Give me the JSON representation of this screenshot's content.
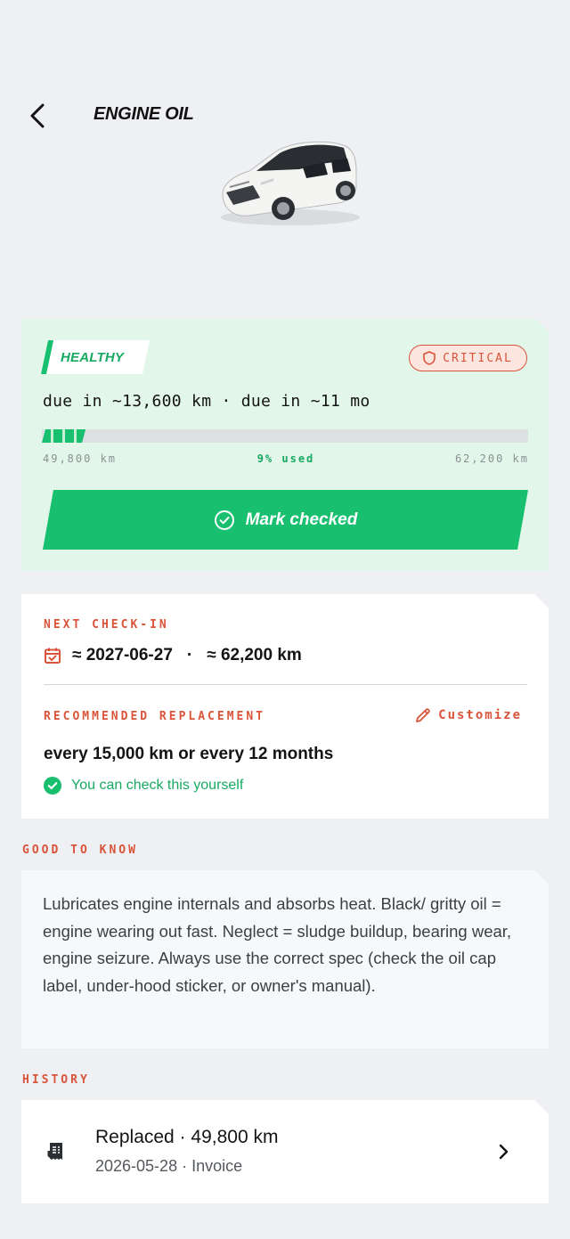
{
  "header": {
    "title": "ENGINE OIL"
  },
  "status": {
    "health": "HEALTHY",
    "severity": "CRITICAL",
    "due_text": "due in ~13,600 km · due in ~11 mo",
    "progress_fraction": 0.09,
    "range_start": "49,800 km",
    "range_used": "9% used",
    "range_end": "62,200 km",
    "mark_button": "Mark checked"
  },
  "checkin": {
    "label": "NEXT CHECK-IN",
    "date": "≈ 2027-06-27",
    "separator": "·",
    "km": "≈ 62,200 km",
    "recommended_label": "RECOMMENDED REPLACEMENT",
    "customize": "Customize",
    "recommended_value": "every 15,000 km or every 12 months",
    "self_check": "You can check this yourself"
  },
  "good_to_know": {
    "label": "GOOD TO KNOW",
    "text": "Lubricates engine internals and absorbs heat. Black/ gritty oil = engine wearing out fast. Neglect = sludge buildup, bearing wear, engine seizure. Always use the correct spec (check the oil cap label, under-hood sticker, or owner's manual)."
  },
  "history": {
    "label": "HISTORY",
    "items": [
      {
        "title": "Replaced · 49,800 km",
        "subtitle": "2026-05-28 · Invoice"
      }
    ]
  },
  "colors": {
    "accent_green": "#18bf6e",
    "accent_red": "#d9543a",
    "card_green": "#e3f6ea",
    "background": "#eef0f3"
  },
  "icons": {
    "back": "chevron-left-icon",
    "severity": "shield-icon",
    "mark": "check-circle-icon",
    "calendar": "calendar-check-icon",
    "customize": "pencil-icon",
    "self_check": "check-circle-filled-icon",
    "history": "receipt-icon",
    "history_open": "chevron-right-icon"
  }
}
